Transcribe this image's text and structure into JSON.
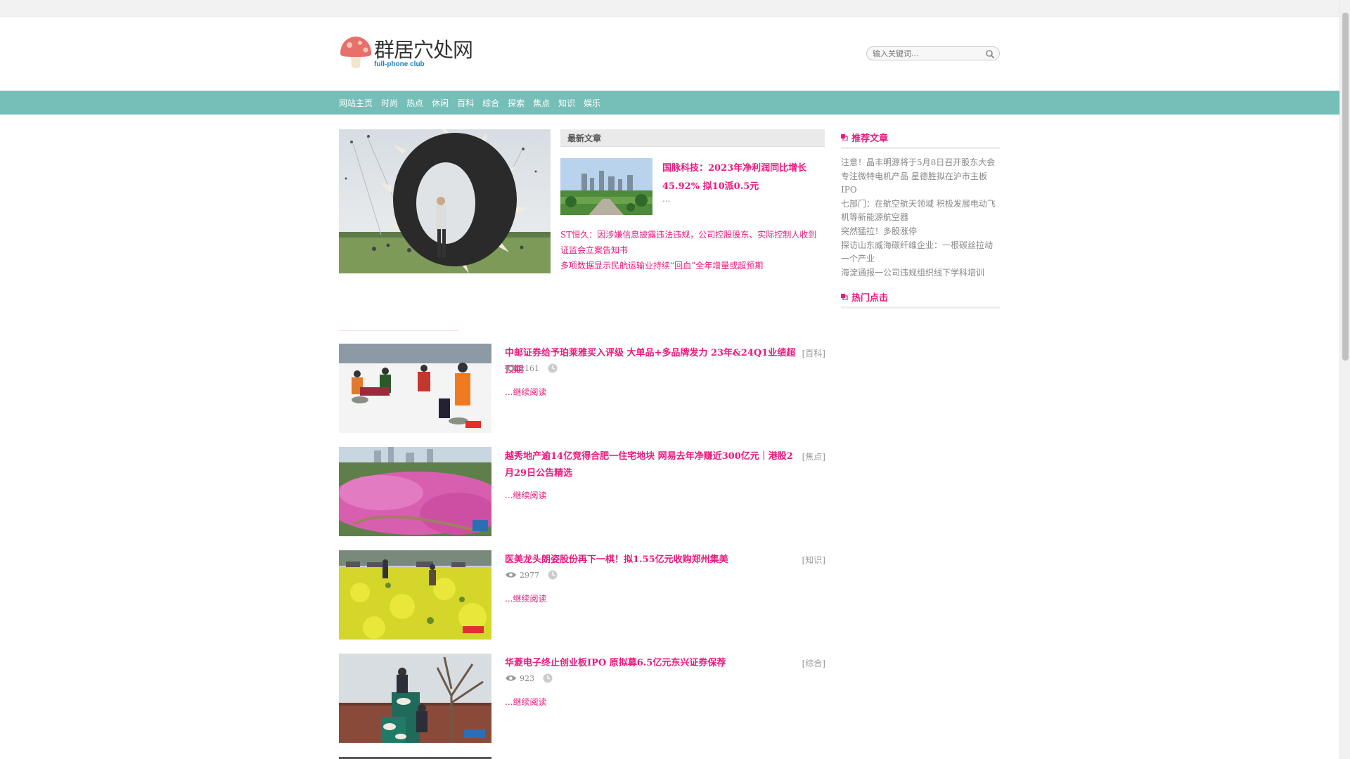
{
  "site": {
    "name": "群居穴处网",
    "sub": "full-phone club"
  },
  "search": {
    "placeholder": "输入关键词..."
  },
  "nav": [
    "网站主页",
    "时尚",
    "热点",
    "休闲",
    "百科",
    "综合",
    "探索",
    "焦点",
    "知识",
    "娱乐"
  ],
  "latest": {
    "heading": "最新文章",
    "top_title": "国脉科技：2023年净利润同比增长45.92% 拟10派0.5元",
    "top_desc": "...",
    "links": [
      "ST恒久：因涉嫌信息披露违法违规，公司控股股东、实际控制人收到证监会立案告知书",
      "多项数据显示民航运输业持续“回血”全年增量或超预期"
    ]
  },
  "articles": [
    {
      "title": "中邮证券给予珀莱雅买入评级 大单品+多品牌发力 23年&24Q1业绩超预期",
      "category": "[百科]",
      "views": "2161",
      "more": "...继续阅读",
      "show_meta": true
    },
    {
      "title": "越秀地产逾14亿竞得合肥一住宅地块 网易去年净赚近300亿元｜港股2月29日公告精选",
      "category": "[焦点]",
      "views": "",
      "more": "...继续阅读",
      "show_meta": false
    },
    {
      "title": "医美龙头朗姿股份再下一棋！拟1.55亿元收购郑州集美",
      "category": "[知识]",
      "views": "2977",
      "more": "...继续阅读",
      "show_meta": true
    },
    {
      "title": "华菱电子终止创业板IPO 原拟募6.5亿元东兴证券保荐",
      "category": "[综合]",
      "views": "923",
      "more": "...继续阅读",
      "show_meta": true
    }
  ],
  "sidebar": {
    "recommend_title": "推荐文章",
    "recommend": [
      "注意！晶丰明源将于5月8日召开股东大会",
      "专注微特电机产品 星德胜拟在沪市主板IPO",
      "七部门：在航空航天领域 积极发展电动飞机等新能源航空器",
      "突然猛拉！多股涨停",
      "探访山东威海碳纤维企业：一根碳丝拉动一个产业",
      "海淀通报一公司违规组织线下学科培训"
    ],
    "hot_title": "热门点击"
  },
  "colors": {
    "accent": "#e9197d",
    "nav_bg": "#75bfb8",
    "logo_mushroom": "#e8706a"
  }
}
